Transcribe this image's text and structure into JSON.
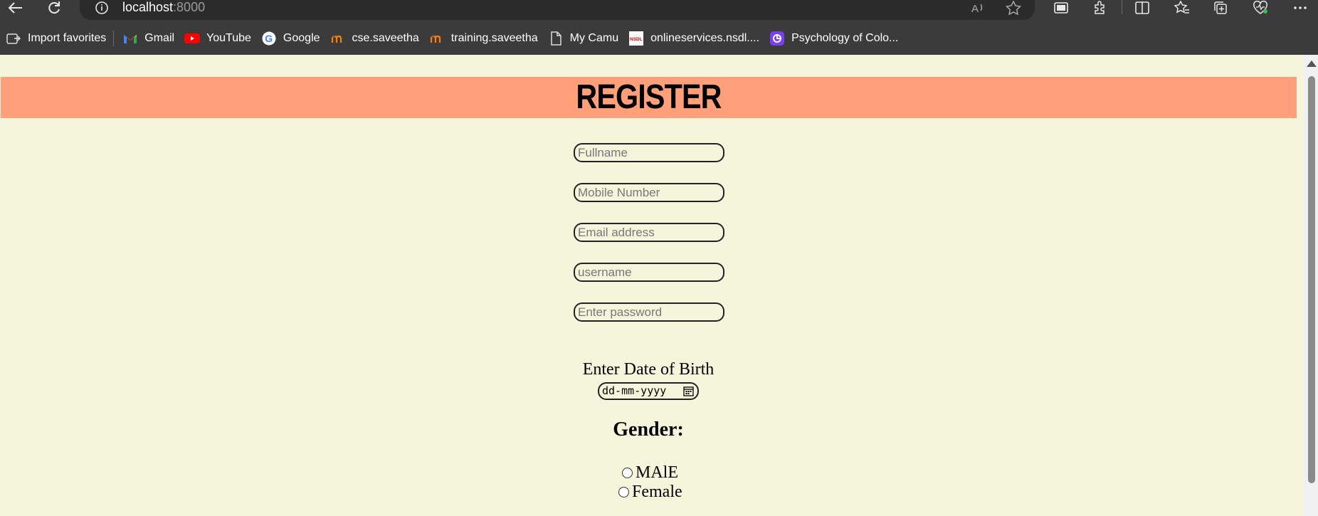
{
  "browser": {
    "url_host": "localhost",
    "url_port": ":8000",
    "bookmarks": [
      {
        "label": "Import favorites",
        "icon": "import-icon"
      },
      {
        "label": "Gmail",
        "icon": "gmail-icon"
      },
      {
        "label": "YouTube",
        "icon": "youtube-icon"
      },
      {
        "label": "Google",
        "icon": "google-icon"
      },
      {
        "label": "cse.saveetha",
        "icon": "moodle-icon"
      },
      {
        "label": "training.saveetha",
        "icon": "moodle-icon"
      },
      {
        "label": "My Camu",
        "icon": "page-icon"
      },
      {
        "label": "onlineservices.nsdl....",
        "icon": "nsdl-icon"
      },
      {
        "label": "Psychology of Colo...",
        "icon": "canva-icon"
      }
    ]
  },
  "form": {
    "title": "REGISTER",
    "fullname_placeholder": "Fullname",
    "mobile_placeholder": "Mobile Number",
    "email_placeholder": "Email address",
    "username_placeholder": "username",
    "password_placeholder": "Enter password",
    "dob_label": "Enter Date of Birth",
    "dob_value": "dd-mm-yyyy",
    "gender_label": "Gender:",
    "gender_options": [
      "MAlE",
      "Female"
    ]
  },
  "colors": {
    "page_bg": "#f5f5dc",
    "header_bg": "#ffa07a",
    "chrome_bg": "#3b3b3b"
  }
}
